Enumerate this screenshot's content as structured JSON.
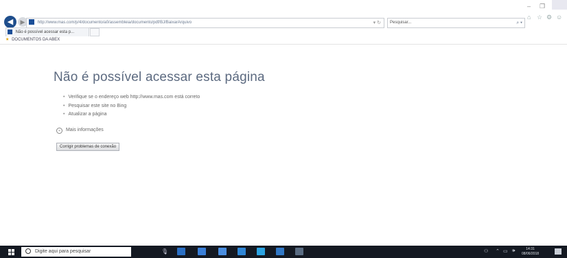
{
  "browser": {
    "address_url": "http://www.mas.com/p/4/documento/a0/assembleia/documento/pdf/BJ/BaixarArquivo",
    "search_placeholder": "Pesquisar...",
    "tab_title": "Não é possível acessar esta p...",
    "favorites_item": "DOCUMENTOS DA ABEX"
  },
  "error_page": {
    "title": "Não é possível acessar esta página",
    "suggestions": [
      "Verifique se o endereço web http://www.mas.com está correto",
      "Pesquisar este site no Bing",
      "Atualizar a página"
    ],
    "more_info": "Mais informações",
    "fix_button": "Corrigir problemas de conexão"
  },
  "taskbar": {
    "search_placeholder": "Digite aqui para pesquisar",
    "time": "14:31",
    "date": "08/06/2018",
    "icon_colors": [
      "#2a6fc4",
      "#3a7fd8",
      "#4a8ee0",
      "#2f86d6",
      "#2ba3e2",
      "#3178c6",
      "#5a6c82"
    ]
  },
  "colors": {
    "title_color": "#5c6a80",
    "taskbar_bg": "#141922"
  }
}
